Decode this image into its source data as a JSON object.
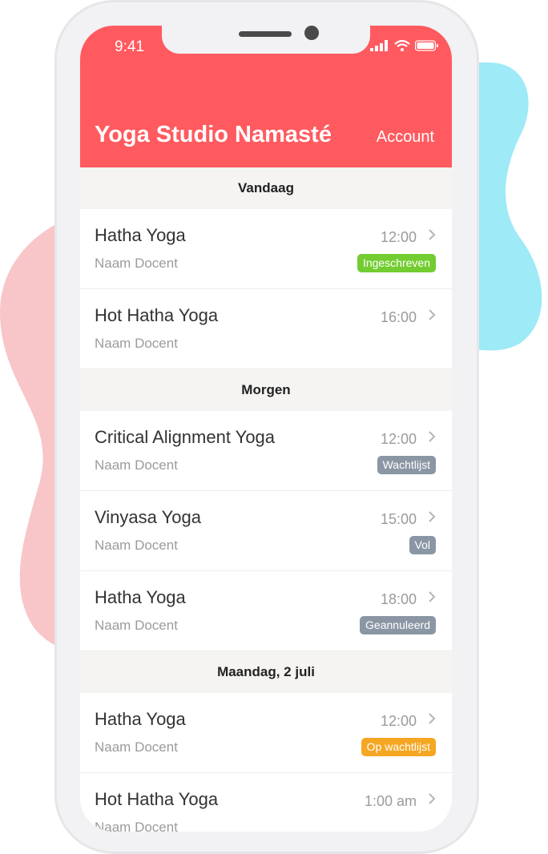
{
  "colors": {
    "header": "#ff5a5f",
    "badge_green": "#73cc31",
    "badge_gray": "#8a96a3",
    "badge_orange": "#f5a623",
    "blob_pink": "#f8c6c8",
    "blob_cyan": "#9eeaf7"
  },
  "status_bar": {
    "time": "9:41"
  },
  "header": {
    "title": "Yoga Studio Namasté",
    "account": "Account"
  },
  "sections": [
    {
      "title": "Vandaag",
      "items": [
        {
          "name": "Hatha Yoga",
          "teacher": "Naam Docent",
          "time": "12:00",
          "badge": "Ingeschreven"
        },
        {
          "name": "Hot Hatha Yoga",
          "teacher": "Naam Docent",
          "time": "16:00"
        }
      ]
    },
    {
      "title": "Morgen",
      "items": [
        {
          "name": "Critical Alignment Yoga",
          "teacher": "Naam Docent",
          "time": "12:00",
          "badge": "Wachtlijst"
        },
        {
          "name": "Vinyasa Yoga",
          "teacher": "Naam Docent",
          "time": "15:00",
          "badge": "Vol"
        },
        {
          "name": "Hatha Yoga",
          "teacher": "Naam Docent",
          "time": "18:00",
          "badge": "Geannuleerd"
        }
      ]
    },
    {
      "title": "Maandag, 2 juli",
      "items": [
        {
          "name": "Hatha Yoga",
          "teacher": "Naam Docent",
          "time": "12:00",
          "badge": "Op wachtlijst"
        },
        {
          "name": "Hot Hatha Yoga",
          "teacher": "Naam Docent",
          "time": "1:00 am"
        }
      ]
    }
  ]
}
